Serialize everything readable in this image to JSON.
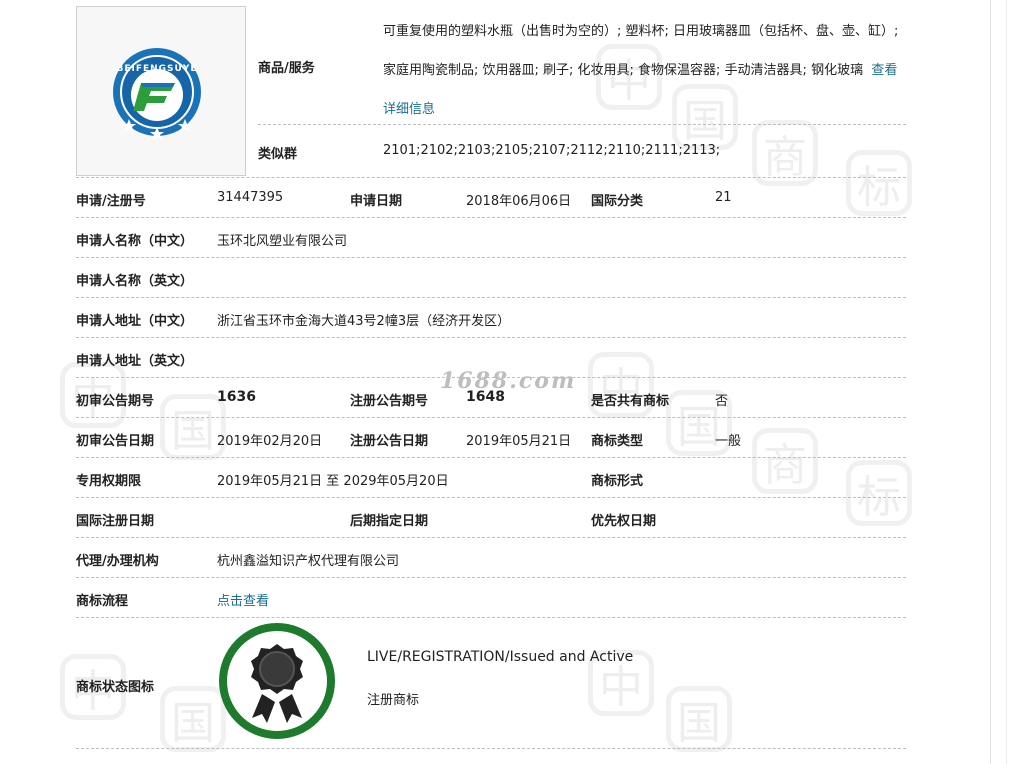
{
  "logo": {
    "text": "BEIFENGSUYE"
  },
  "goods": {
    "label": "商品/服务",
    "text": "可重复使用的塑料水瓶（出售时为空的）; 塑料杯; 日用玻璃器皿（包括杯、盘、壶、缸）; 家庭用陶瓷制品; 饮用器皿; 刷子; 化妆用具; 食物保温容器; 手动清洁器具; 钢化玻璃",
    "more_link": "查看详细信息"
  },
  "similar_group": {
    "label": "类似群",
    "value": "2101;2102;2103;2105;2107;2112;2110;2111;2113;"
  },
  "rows": {
    "reg_no": {
      "label": "申请/注册号",
      "value": "31447395"
    },
    "apply_date": {
      "label": "申请日期",
      "value": "2018年06月06日"
    },
    "intl_class": {
      "label": "国际分类",
      "value": "21"
    },
    "applicant_cn": {
      "label": "申请人名称（中文）",
      "value": "玉环北风塑业有限公司"
    },
    "applicant_en": {
      "label": "申请人名称（英文）",
      "value": ""
    },
    "address_cn": {
      "label": "申请人地址（中文）",
      "value": "浙江省玉环市金海大道43号2幢3层（经济开发区）"
    },
    "address_en": {
      "label": "申请人地址（英文）",
      "value": ""
    },
    "prelim_no": {
      "label": "初审公告期号",
      "value": "1636"
    },
    "reg_pub_no": {
      "label": "注册公告期号",
      "value": "1648"
    },
    "shared": {
      "label": "是否共有商标",
      "value": "否"
    },
    "prelim_date": {
      "label": "初审公告日期",
      "value": "2019年02月20日"
    },
    "reg_pub_date": {
      "label": "注册公告日期",
      "value": "2019年05月21日"
    },
    "mark_type": {
      "label": "商标类型",
      "value": "一般"
    },
    "exclusive": {
      "label": "专用权期限",
      "value": "2019年05月21日 至 2029年05月20日"
    },
    "mark_form": {
      "label": "商标形式",
      "value": ""
    },
    "intl_reg_date": {
      "label": "国际注册日期",
      "value": ""
    },
    "later_date": {
      "label": "后期指定日期",
      "value": ""
    },
    "priority_date": {
      "label": "优先权日期",
      "value": ""
    },
    "agent": {
      "label": "代理/办理机构",
      "value": "杭州鑫溢知识产权代理有限公司"
    },
    "flow": {
      "label": "商标流程",
      "value": "点击查看"
    }
  },
  "status": {
    "label": "商标状态图标",
    "en": "LIVE/REGISTRATION/Issued and Active",
    "cn": "注册商标"
  },
  "watermark": {
    "site": "1688.com",
    "chars": [
      "中",
      "国",
      "商",
      "标"
    ]
  },
  "colors": {
    "link": "#1a6c8c",
    "badge_ring": "#1e7a2c",
    "logo_blue": "#1a73b8",
    "logo_green": "#2c9d3a"
  }
}
